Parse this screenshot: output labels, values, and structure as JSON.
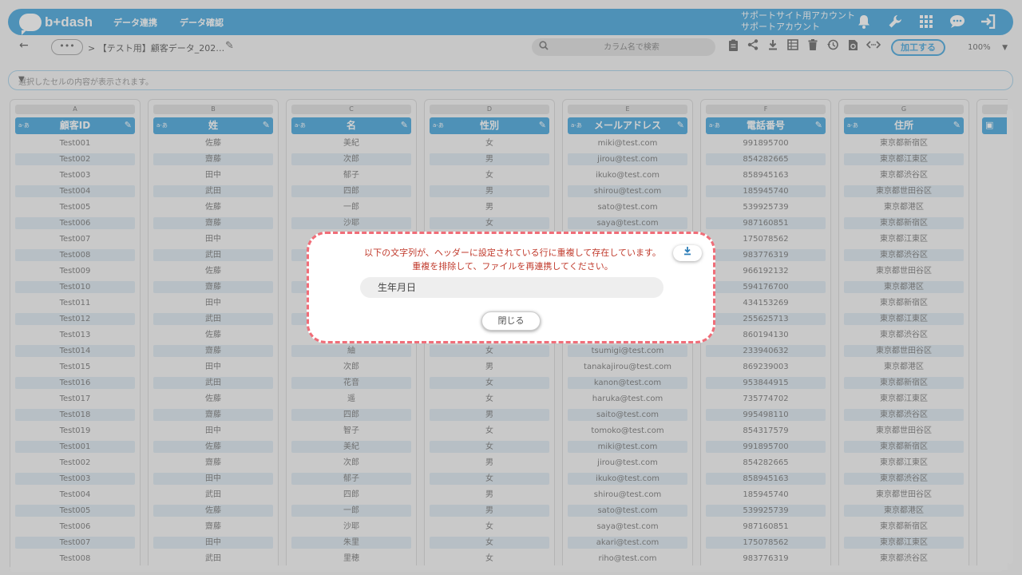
{
  "app": {
    "logo_text": "b+dash",
    "nav": [
      "データ連携",
      "データ確認"
    ],
    "account_line1": "サポートサイト用アカウント",
    "account_line2": "サポートアカウント"
  },
  "toolbar": {
    "more_label": "•••",
    "breadcrumb": "> 【テスト用】顧客データ_202…",
    "search_placeholder": "カラム名で検索",
    "process_button": "加工する",
    "zoom": "100%"
  },
  "cellbar": {
    "placeholder": "選択したセルの内容が表示されます。"
  },
  "columns": [
    {
      "letter": "A",
      "type": "a-あ",
      "name": "顧客ID"
    },
    {
      "letter": "B",
      "type": "a-あ",
      "name": "姓"
    },
    {
      "letter": "C",
      "type": "a-あ",
      "name": "名"
    },
    {
      "letter": "D",
      "type": "a-あ",
      "name": "性別"
    },
    {
      "letter": "E",
      "type": "a-あ",
      "name": "メールアドレス"
    },
    {
      "letter": "F",
      "type": "a-あ",
      "name": "電話番号"
    },
    {
      "letter": "G",
      "type": "a-あ",
      "name": "住所"
    }
  ],
  "rows": [
    [
      "Test001",
      "佐藤",
      "美紀",
      "女",
      "miki@test.com",
      "991895700",
      "東京都新宿区"
    ],
    [
      "Test002",
      "齋藤",
      "次郎",
      "男",
      "jirou@test.com",
      "854282665",
      "東京都江東区"
    ],
    [
      "Test003",
      "田中",
      "郁子",
      "女",
      "ikuko@test.com",
      "858945163",
      "東京都渋谷区"
    ],
    [
      "Test004",
      "武田",
      "四郎",
      "男",
      "shirou@test.com",
      "185945740",
      "東京都世田谷区"
    ],
    [
      "Test005",
      "佐藤",
      "一郎",
      "男",
      "sato@test.com",
      "539925739",
      "東京都港区"
    ],
    [
      "Test006",
      "齋藤",
      "沙耶",
      "女",
      "saya@test.com",
      "987160851",
      "東京都新宿区"
    ],
    [
      "Test007",
      "田中",
      "",
      "",
      "",
      "175078562",
      "東京都江東区"
    ],
    [
      "Test008",
      "武田",
      "",
      "",
      "",
      "983776319",
      "東京都渋谷区"
    ],
    [
      "Test009",
      "佐藤",
      "",
      "",
      "",
      "966192132",
      "東京都世田谷区"
    ],
    [
      "Test010",
      "齋藤",
      "",
      "",
      "",
      "594176700",
      "東京都港区"
    ],
    [
      "Test011",
      "田中",
      "",
      "",
      "",
      "434153269",
      "東京都新宿区"
    ],
    [
      "Test012",
      "武田",
      "",
      "",
      "",
      "255625713",
      "東京都江東区"
    ],
    [
      "Test013",
      "佐藤",
      "",
      "",
      "",
      "860194130",
      "東京都渋谷区"
    ],
    [
      "Test014",
      "齋藤",
      "紬",
      "女",
      "tsumigi@test.com",
      "233940632",
      "東京都世田谷区"
    ],
    [
      "Test015",
      "田中",
      "次郎",
      "男",
      "tanakajirou@test.com",
      "869239003",
      "東京都港区"
    ],
    [
      "Test016",
      "武田",
      "花音",
      "女",
      "kanon@test.com",
      "953844915",
      "東京都新宿区"
    ],
    [
      "Test017",
      "佐藤",
      "遥",
      "女",
      "haruka@test.com",
      "735774702",
      "東京都江東区"
    ],
    [
      "Test018",
      "齋藤",
      "四郎",
      "男",
      "saito@test.com",
      "995498110",
      "東京都渋谷区"
    ],
    [
      "Test019",
      "田中",
      "智子",
      "女",
      "tomoko@test.com",
      "854317579",
      "東京都世田谷区"
    ],
    [
      "Test001",
      "佐藤",
      "美紀",
      "女",
      "miki@test.com",
      "991895700",
      "東京都新宿区"
    ],
    [
      "Test002",
      "齋藤",
      "次郎",
      "男",
      "jirou@test.com",
      "854282665",
      "東京都江東区"
    ],
    [
      "Test003",
      "田中",
      "郁子",
      "女",
      "ikuko@test.com",
      "858945163",
      "東京都渋谷区"
    ],
    [
      "Test004",
      "武田",
      "四郎",
      "男",
      "shirou@test.com",
      "185945740",
      "東京都世田谷区"
    ],
    [
      "Test005",
      "佐藤",
      "一郎",
      "男",
      "sato@test.com",
      "539925739",
      "東京都港区"
    ],
    [
      "Test006",
      "齋藤",
      "沙耶",
      "女",
      "saya@test.com",
      "987160851",
      "東京都新宿区"
    ],
    [
      "Test007",
      "田中",
      "朱里",
      "女",
      "akari@test.com",
      "175078562",
      "東京都江東区"
    ],
    [
      "Test008",
      "武田",
      "里穂",
      "女",
      "riho@test.com",
      "983776319",
      "東京都渋谷区"
    ]
  ],
  "dialog": {
    "message_line1": "以下の文字列が、ヘッダーに設定されている行に重複して存在しています。",
    "message_line2": "重複を排除して、ファイルを再連携してください。",
    "duplicate_item": "生年月日",
    "close_label": "閉じる"
  },
  "colors": {
    "brand": "#2f9cd8",
    "dialog_border": "#f06d78",
    "dialog_text": "#c0392b"
  }
}
